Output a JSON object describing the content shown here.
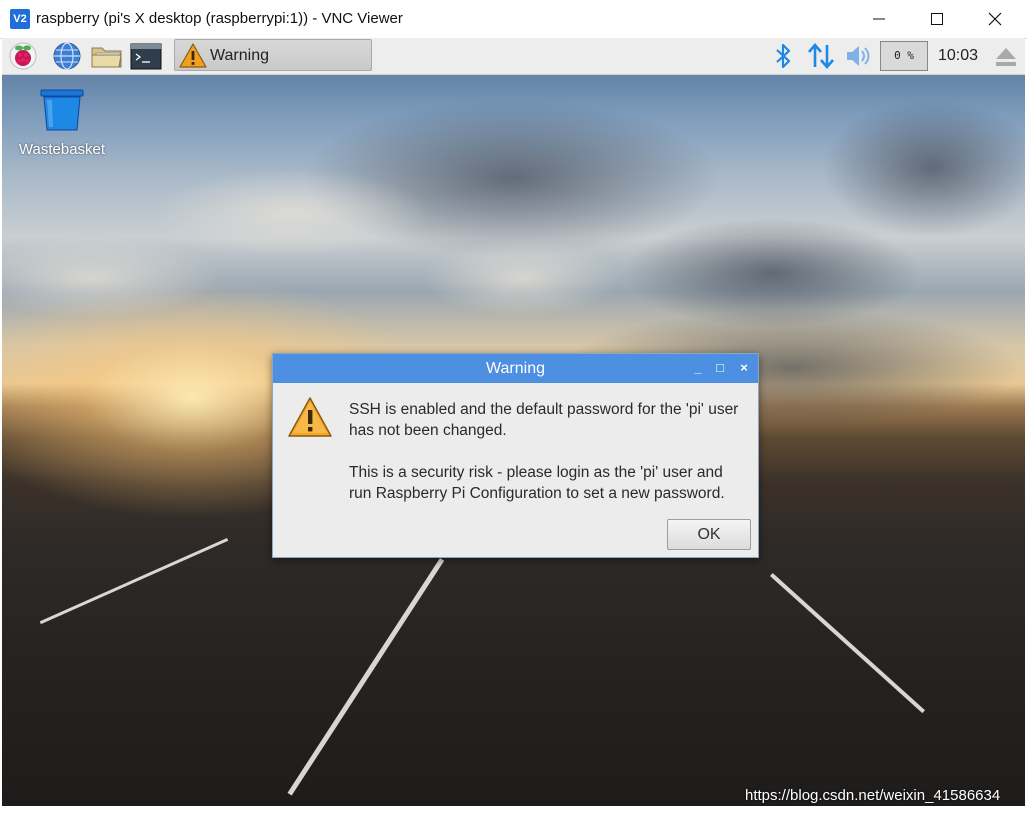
{
  "window": {
    "title": "raspberry (pi's X desktop (raspberrypi:1)) - VNC Viewer",
    "logo_text": "V2",
    "icons": {
      "minimize": "minimize-icon",
      "maximize": "maximize-icon",
      "close": "close-icon"
    }
  },
  "taskbar": {
    "launchers": [
      {
        "name": "raspberry-menu-icon"
      },
      {
        "name": "web-browser-icon"
      },
      {
        "name": "file-manager-icon"
      },
      {
        "name": "terminal-icon"
      }
    ],
    "task_button": {
      "label": "Warning",
      "icon": "warning-icon"
    },
    "tray": {
      "bluetooth_icon": "bluetooth-icon",
      "network_icon": "network-transfer-icon",
      "volume_icon": "volume-icon",
      "cpu_usage": "0 %",
      "clock": "10:03",
      "eject_icon": "eject-icon"
    }
  },
  "desktop": {
    "icons": [
      {
        "label": "Wastebasket",
        "icon": "wastebasket-icon"
      }
    ]
  },
  "dialog": {
    "title": "Warning",
    "message_line1": "SSH is enabled and the default password for the 'pi' user\nhas not been changed.",
    "message_line2": "This is a security risk - please login as the 'pi' user and\nrun Raspberry Pi Configuration to set a new password.",
    "ok_label": "OK",
    "controls": {
      "minimize": "_",
      "maximize": "□",
      "close": "×"
    }
  },
  "watermark": "https://blog.csdn.net/weixin_41586634",
  "colors": {
    "dialog_title_bg": "#4d8fe0",
    "accent_blue": "#1e88e5",
    "warning_orange": "#f0a020"
  }
}
